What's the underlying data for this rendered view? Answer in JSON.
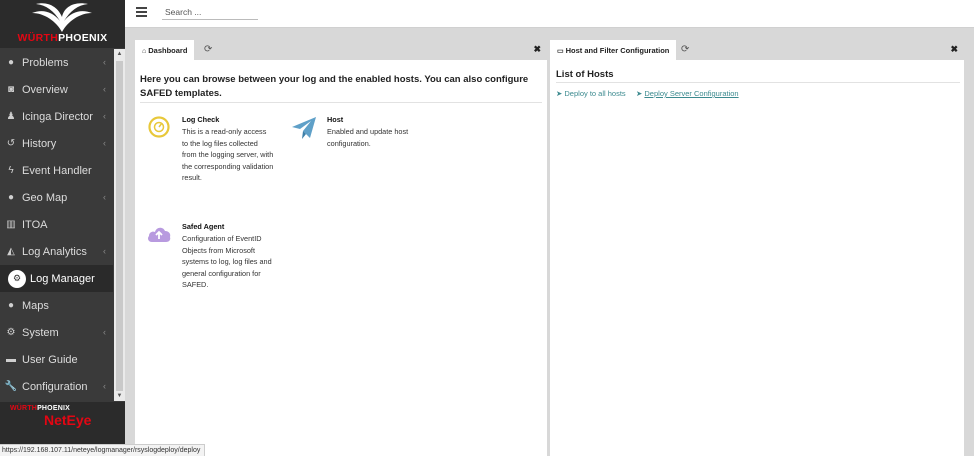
{
  "brand": {
    "logo_text_red": "WÜRTH",
    "logo_text_white": "PHOENIX",
    "footer_brand_red": "WÜRTH",
    "footer_brand_white": "PHOENIX",
    "footer_product": "NetEye",
    "accent_red": "#e30613"
  },
  "topbar": {
    "search_placeholder": "Search ..."
  },
  "sidebar": {
    "items": [
      {
        "label": "Problems",
        "icon": "exclamation-circle-icon",
        "chevron": true
      },
      {
        "label": "Overview",
        "icon": "binoculars-icon",
        "chevron": true
      },
      {
        "label": "Icinga Director",
        "icon": "user-tie-icon",
        "chevron": true
      },
      {
        "label": "History",
        "icon": "history-icon",
        "chevron": true
      },
      {
        "label": "Event Handler",
        "icon": "bolt-icon",
        "chevron": false
      },
      {
        "label": "Geo Map",
        "icon": "globe-icon",
        "chevron": true
      },
      {
        "label": "ITOA",
        "icon": "bar-chart-icon",
        "chevron": false
      },
      {
        "label": "Log Analytics",
        "icon": "area-chart-icon",
        "chevron": true
      },
      {
        "label": "Log Manager",
        "icon": "cogs-icon",
        "chevron": false,
        "active": true
      },
      {
        "label": "Maps",
        "icon": "globe-icon",
        "chevron": false
      },
      {
        "label": "System",
        "icon": "cogs-icon",
        "chevron": true
      },
      {
        "label": "User Guide",
        "icon": "book-icon",
        "chevron": false
      },
      {
        "label": "Configuration",
        "icon": "wrench-icon",
        "chevron": true
      }
    ]
  },
  "left_panel": {
    "tab_label": "Dashboard",
    "intro": "Here you can browse between your log and the enabled hosts. You can also configure SAFED templates.",
    "cards": {
      "log_check": {
        "title": "Log Check",
        "description": "This is a read-only access to the log files collected from the logging server, with the corresponding validation result."
      },
      "host": {
        "title": "Host",
        "description": "Enabled and update host configuration."
      },
      "safed_agent": {
        "title": "Safed Agent",
        "description": "Configuration of EventID Objects from Microsoft systems to log, log files and general configuration for SAFED."
      }
    }
  },
  "right_panel": {
    "tab_label": "Host and Filter Configuration",
    "heading": "List of Hosts",
    "deploy_all": "Deploy to all hosts",
    "deploy_server": "Deploy Server Configuration",
    "link_color": "#3c8a8f"
  },
  "status_bar": {
    "url": "https://192.168.107.11/neteye/logmanager/rsyslogdeploy/deploy"
  }
}
